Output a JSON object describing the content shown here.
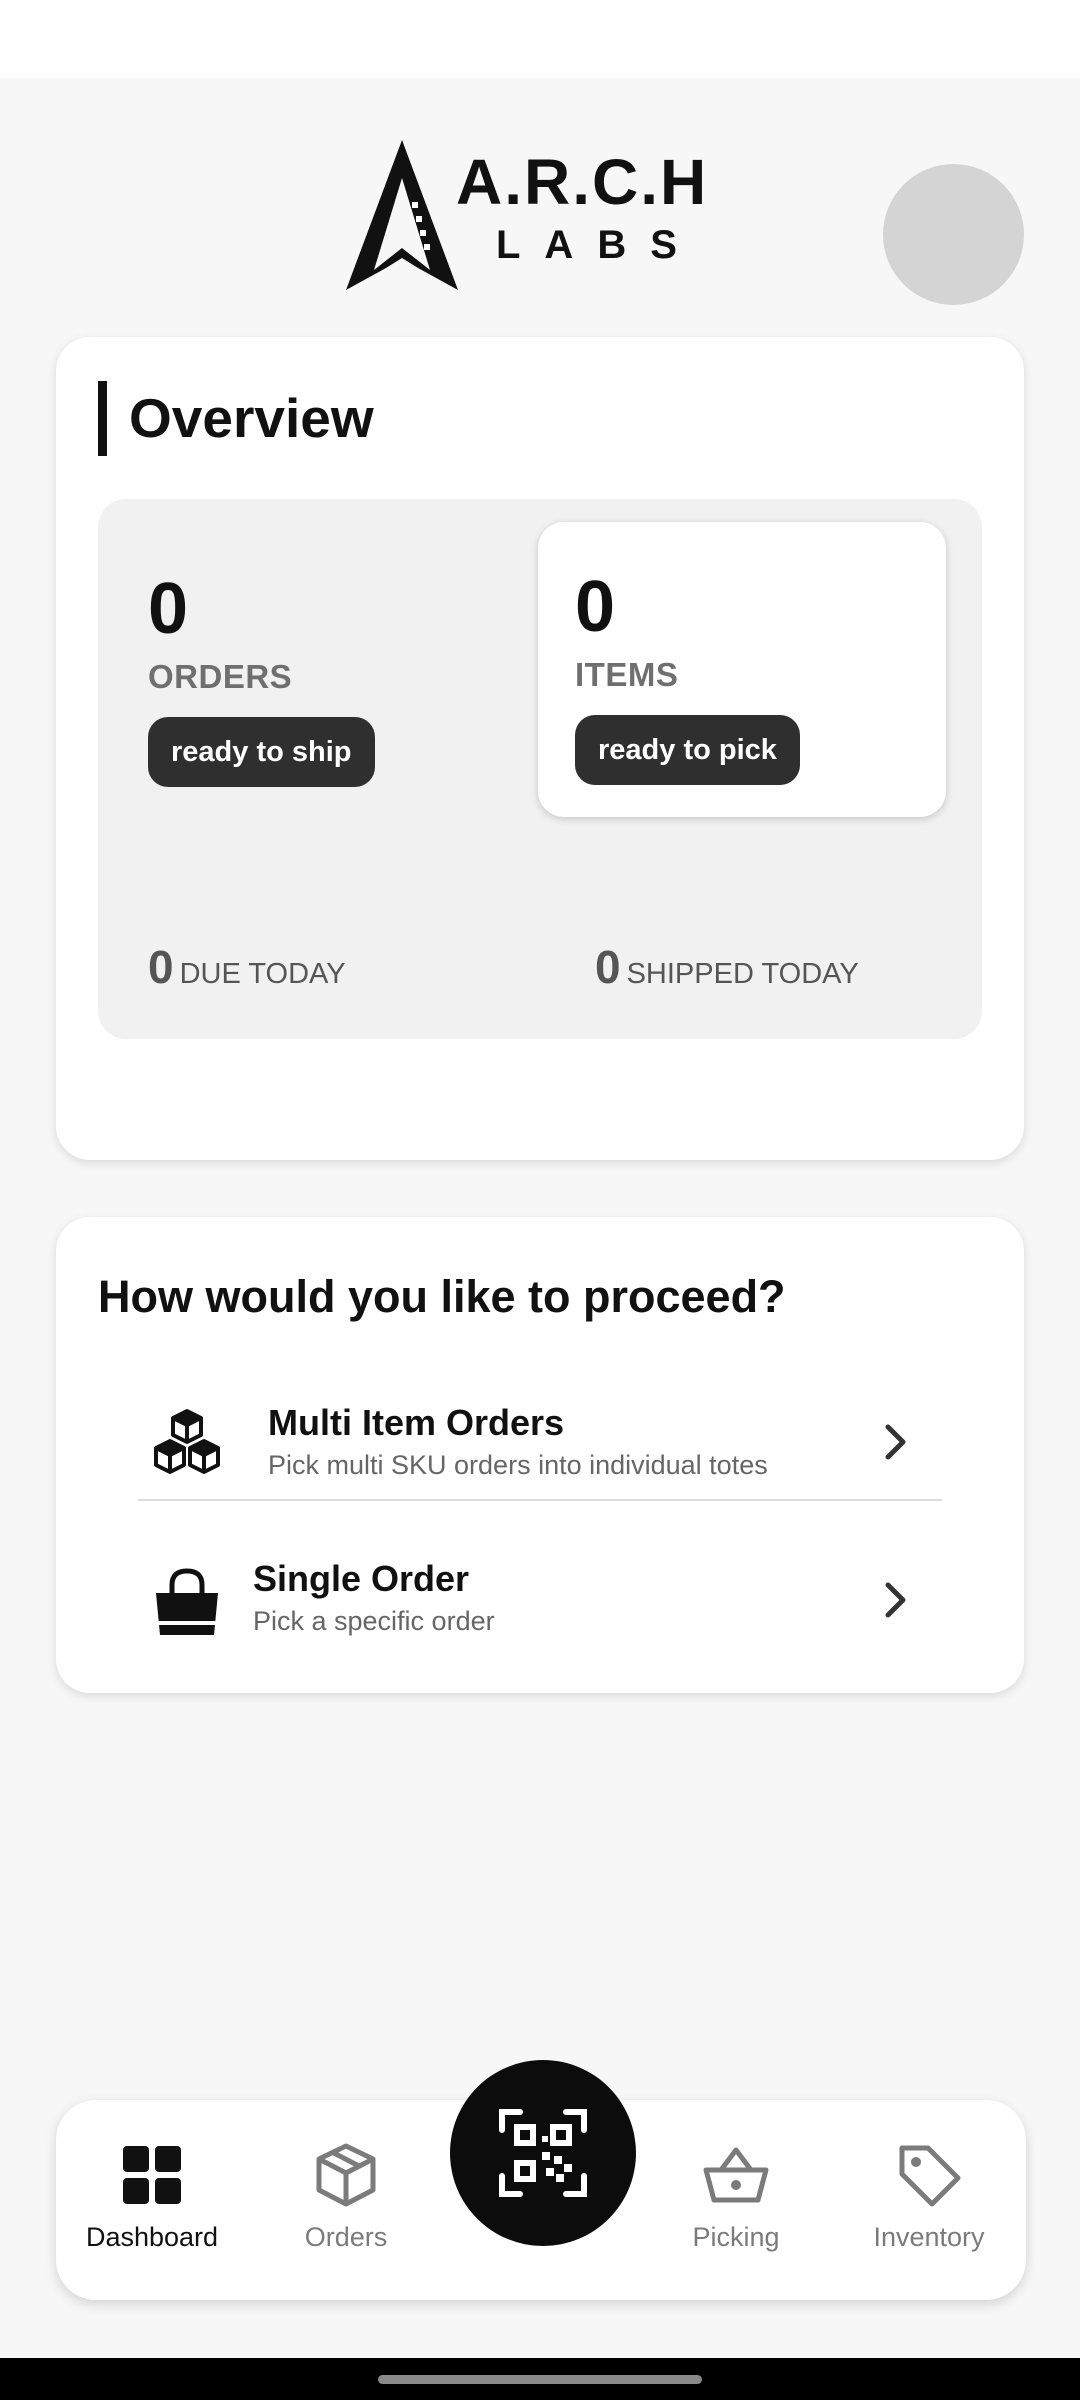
{
  "brand": {
    "name_line1": "A.R.C.H",
    "name_line2": "LABS"
  },
  "overview": {
    "title": "Overview",
    "orders": {
      "count": "0",
      "label": "ORDERS",
      "badge": "ready to ship"
    },
    "items": {
      "count": "0",
      "label": "ITEMS",
      "badge": "ready to pick"
    },
    "due_today": {
      "count": "0",
      "label": "DUE TODAY"
    },
    "shipped_today": {
      "count": "0",
      "label": "SHIPPED TODAY"
    }
  },
  "proceed": {
    "title": "How would you like to proceed?",
    "options": [
      {
        "title": "Multi Item Orders",
        "subtitle": "Pick multi SKU orders into individual totes",
        "icon": "cubes-icon"
      },
      {
        "title": "Single Order",
        "subtitle": "Pick a specific order",
        "icon": "shopping-bag-icon"
      }
    ]
  },
  "nav": {
    "items": [
      {
        "label": "Dashboard",
        "icon": "grid-icon",
        "active": true
      },
      {
        "label": "Orders",
        "icon": "box-icon",
        "active": false
      },
      {
        "label": "Picking",
        "icon": "basket-icon",
        "active": false
      },
      {
        "label": "Inventory",
        "icon": "tag-icon",
        "active": false
      }
    ],
    "fab_icon": "qr-scan-icon"
  },
  "colors": {
    "background": "#f7f7f7",
    "card": "#ffffff",
    "accent_dark": "#2f2f2f",
    "avatar": "#d4d4d4"
  }
}
